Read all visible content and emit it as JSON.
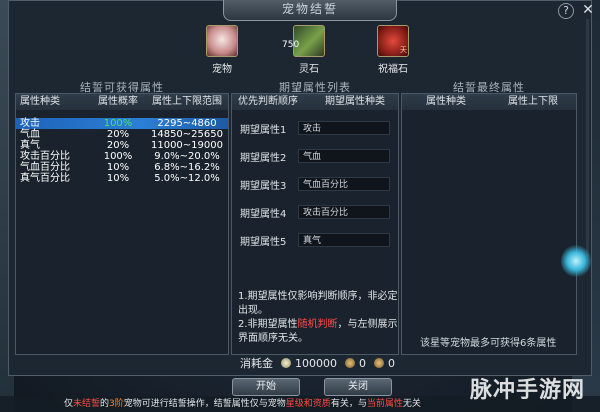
{
  "window": {
    "title": "宠物结誓",
    "help": "?",
    "close": "✕"
  },
  "items": [
    {
      "label": "宠物",
      "icon": "pet-icon"
    },
    {
      "label": "灵石",
      "count": "750",
      "icon": "spirit-stone-icon"
    },
    {
      "label": "祝福石",
      "tag": "天",
      "icon": "bless-stone-icon"
    }
  ],
  "left_panel": {
    "title": "结誓可获得属性",
    "headers": [
      "属性种类",
      "属性概率",
      "属性上下限范围"
    ],
    "rows": [
      {
        "type": "攻击",
        "prob": "100%",
        "range": "2295~4860",
        "selected": true
      },
      {
        "type": "气血",
        "prob": "20%",
        "range": "14850~25650"
      },
      {
        "type": "真气",
        "prob": "20%",
        "range": "11000~19000"
      },
      {
        "type": "攻击百分比",
        "prob": "100%",
        "range": "9.0%~20.0%"
      },
      {
        "type": "气血百分比",
        "prob": "10%",
        "range": "6.8%~16.2%"
      },
      {
        "type": "真气百分比",
        "prob": "10%",
        "range": "5.0%~12.0%"
      }
    ]
  },
  "mid_panel": {
    "title": "期望属性列表",
    "headers": [
      "优先判断顺序",
      "期望属性种类"
    ],
    "rows": [
      {
        "label": "期望属性1",
        "value": "攻击"
      },
      {
        "label": "期望属性2",
        "value": "气血"
      },
      {
        "label": "期望属性3",
        "value": "气血百分比"
      },
      {
        "label": "期望属性4",
        "value": "攻击百分比"
      },
      {
        "label": "期望属性5",
        "value": "真气"
      }
    ],
    "note1": "1.期望属性仅影响判断顺序，非必定出现。",
    "note2_a": "2.非期望属性",
    "note2_red": "随机判断",
    "note2_b": "，与左侧展示界面顺序无关。"
  },
  "right_panel": {
    "title": "结誓最终属性",
    "headers": [
      "属性种类",
      "属性上下限"
    ],
    "note": "该星等宠物最多可获得6条属性"
  },
  "cost": {
    "label": "消耗金",
    "amount1": "100000",
    "amount2": "0",
    "amount3": "0"
  },
  "buttons": {
    "start": "开始",
    "close": "关闭"
  },
  "bottom_text": {
    "p1": "仅",
    "p2": "未结誓",
    "p3": "的",
    "p4": "3阶",
    "p5": "宠物可进行结誓操作，结誓属性仅与宠物",
    "p6": "星级和资质",
    "p7": "有关，与",
    "p8": "当前属性",
    "p9": "无关"
  },
  "watermark": "脉冲手游网",
  "colors": {
    "selected_row": "#2c7fd6",
    "highlight_green": "#4fe06a",
    "warning_red": "#ff4b45"
  }
}
